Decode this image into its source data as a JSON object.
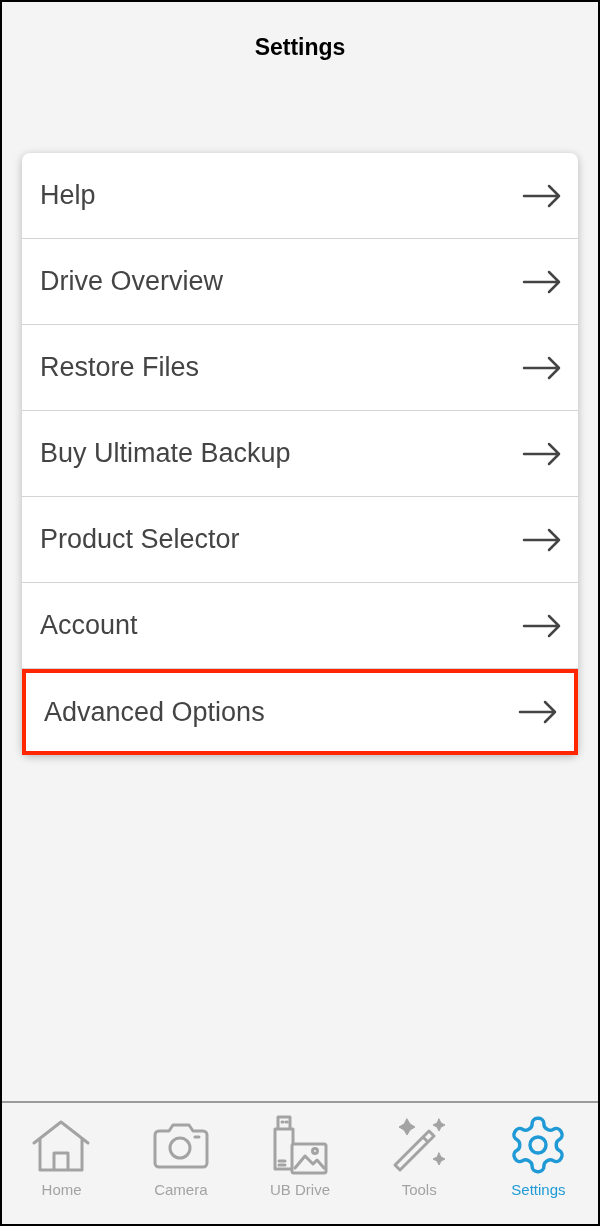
{
  "header": {
    "title": "Settings"
  },
  "menu": [
    {
      "label": "Help",
      "highlighted": false
    },
    {
      "label": "Drive Overview",
      "highlighted": false
    },
    {
      "label": "Restore Files",
      "highlighted": false
    },
    {
      "label": "Buy Ultimate Backup",
      "highlighted": false
    },
    {
      "label": "Product Selector",
      "highlighted": false
    },
    {
      "label": "Account",
      "highlighted": false
    },
    {
      "label": "Advanced Options",
      "highlighted": true
    }
  ],
  "tab_bar": [
    {
      "kind": "home",
      "label": "Home",
      "selected": false
    },
    {
      "kind": "camera",
      "label": "Camera",
      "selected": false
    },
    {
      "kind": "drive",
      "label": "UB Drive",
      "selected": false
    },
    {
      "kind": "tools",
      "label": "Tools",
      "selected": false
    },
    {
      "kind": "settings",
      "label": "Settings",
      "selected": true
    }
  ]
}
